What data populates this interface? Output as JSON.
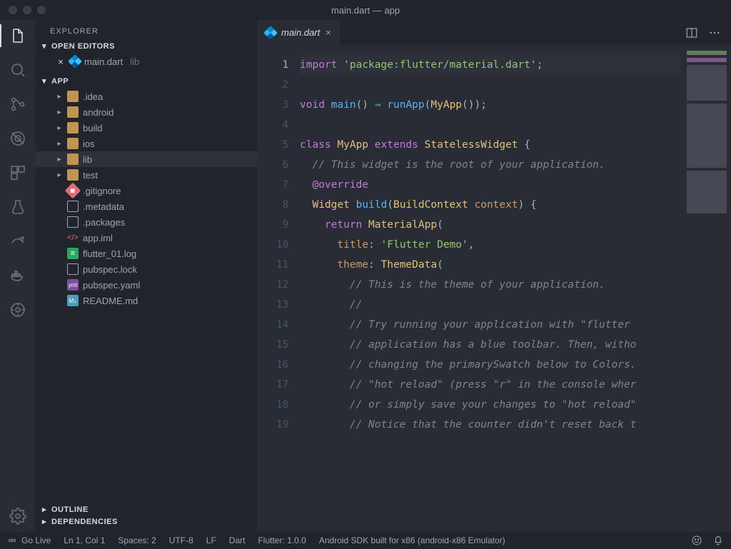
{
  "window": {
    "title": "main.dart — app"
  },
  "sidebar": {
    "title": "EXPLORER",
    "openEditorsLabel": "OPEN EDITORS",
    "openEditors": [
      {
        "name": "main.dart",
        "folder": "lib"
      }
    ],
    "projectLabel": "APP",
    "tree": [
      {
        "label": ".idea",
        "type": "folder"
      },
      {
        "label": "android",
        "type": "folder"
      },
      {
        "label": "build",
        "type": "folder"
      },
      {
        "label": "ios",
        "type": "folder"
      },
      {
        "label": "lib",
        "type": "folder",
        "selected": true
      },
      {
        "label": "test",
        "type": "folder"
      },
      {
        "label": ".gitignore",
        "type": "git"
      },
      {
        "label": ".metadata",
        "type": "file"
      },
      {
        "label": ".packages",
        "type": "file"
      },
      {
        "label": "app.iml",
        "type": "code"
      },
      {
        "label": "flutter_01.log",
        "type": "log"
      },
      {
        "label": "pubspec.lock",
        "type": "file"
      },
      {
        "label": "pubspec.yaml",
        "type": "yaml"
      },
      {
        "label": "README.md",
        "type": "md"
      }
    ],
    "outlineLabel": "OUTLINE",
    "dependenciesLabel": "DEPENDENCIES"
  },
  "tab": {
    "label": "main.dart"
  },
  "code": {
    "lines": [
      {
        "n": 1,
        "html": "<span class='kw'>import</span> <span class='str'>'package:flutter/material.dart'</span>;"
      },
      {
        "n": 2,
        "html": ""
      },
      {
        "n": 3,
        "html": "<span class='kw'>void</span> <span class='fn'>main</span>() <span class='op'>⇒</span> <span class='fn'>runApp</span>(<span class='cls'>MyApp</span>());"
      },
      {
        "n": 4,
        "html": ""
      },
      {
        "n": 5,
        "html": "<span class='kw'>class</span> <span class='cls'>MyApp</span> <span class='kw'>extends</span> <span class='cls'>StatelessWidget</span> {"
      },
      {
        "n": 6,
        "html": "  <span class='cmt'>// This widget is the root of your application.</span>"
      },
      {
        "n": 7,
        "html": "  <span class='anno'>@override</span>"
      },
      {
        "n": 8,
        "html": "  <span class='cls'>Widget</span> <span class='fn'>build</span>(<span class='cls'>BuildContext</span> <span class='prm2'>context</span>) {"
      },
      {
        "n": 9,
        "html": "    <span class='kw'>return</span> <span class='cls'>MaterialApp</span>("
      },
      {
        "n": 10,
        "html": "      <span class='prm2'>title</span>: <span class='str'>'Flutter Demo'</span>,"
      },
      {
        "n": 11,
        "html": "      <span class='prm2'>theme</span>: <span class='cls'>ThemeData</span>("
      },
      {
        "n": 12,
        "html": "        <span class='cmt'>// This is the theme of your application.</span>"
      },
      {
        "n": 13,
        "html": "        <span class='cmt'>//</span>"
      },
      {
        "n": 14,
        "html": "        <span class='cmt'>// Try running your application with \"flutter </span>"
      },
      {
        "n": 15,
        "html": "        <span class='cmt'>// application has a blue toolbar. Then, witho</span>"
      },
      {
        "n": 16,
        "html": "        <span class='cmt'>// changing the primarySwatch below to Colors.</span>"
      },
      {
        "n": 17,
        "html": "        <span class='cmt'>// \"hot reload\" (press \"r\" in the console wher</span>"
      },
      {
        "n": 18,
        "html": "        <span class='cmt'>// or simply save your changes to \"hot reload\"</span>"
      },
      {
        "n": 19,
        "html": "        <span class='cmt'>// Notice that the counter didn't reset back t</span>"
      }
    ]
  },
  "status": {
    "goLive": "Go Live",
    "cursor": "Ln 1, Col 1",
    "spaces": "Spaces: 2",
    "encoding": "UTF-8",
    "eol": "LF",
    "lang": "Dart",
    "flutter": "Flutter: 1.0.0",
    "device": "Android SDK built for x86 (android-x86 Emulator)"
  }
}
